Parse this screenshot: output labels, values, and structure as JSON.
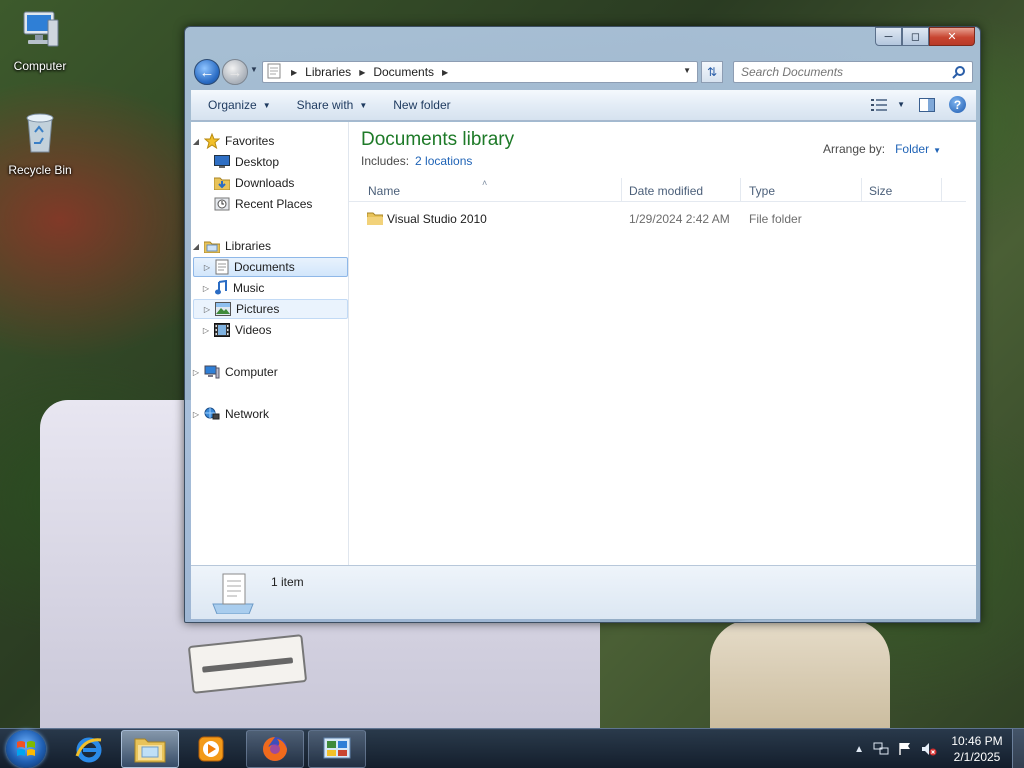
{
  "desktop": {
    "icons": [
      {
        "label": "Computer"
      },
      {
        "label": "Recycle Bin"
      }
    ]
  },
  "window": {
    "address": {
      "crumbs": [
        "Libraries",
        "Documents"
      ]
    },
    "search": {
      "placeholder": "Search Documents"
    },
    "toolbar": {
      "organize": "Organize",
      "share_with": "Share with",
      "new_folder": "New folder"
    },
    "nav": {
      "favorites": "Favorites",
      "desktop": "Desktop",
      "downloads": "Downloads",
      "recent_places": "Recent Places",
      "libraries": "Libraries",
      "documents": "Documents",
      "music": "Music",
      "pictures": "Pictures",
      "videos": "Videos",
      "computer": "Computer",
      "network": "Network"
    },
    "library": {
      "title": "Documents library",
      "includes_label": "Includes:",
      "includes_link": "2 locations",
      "arrange_label": "Arrange by:",
      "arrange_value": "Folder"
    },
    "columns": {
      "name": "Name",
      "date_modified": "Date modified",
      "type": "Type",
      "size": "Size"
    },
    "files": [
      {
        "name": "Visual Studio 2010",
        "date_modified": "1/29/2024 2:42 AM",
        "type": "File folder",
        "size": ""
      }
    ],
    "details": {
      "count": "1 item"
    }
  },
  "taskbar": {
    "clock": {
      "time": "10:46 PM",
      "date": "2/1/2025"
    }
  },
  "colors": {
    "library_title": "#1e7a28",
    "link": "#1f63b6",
    "close_button": "#c84531"
  }
}
